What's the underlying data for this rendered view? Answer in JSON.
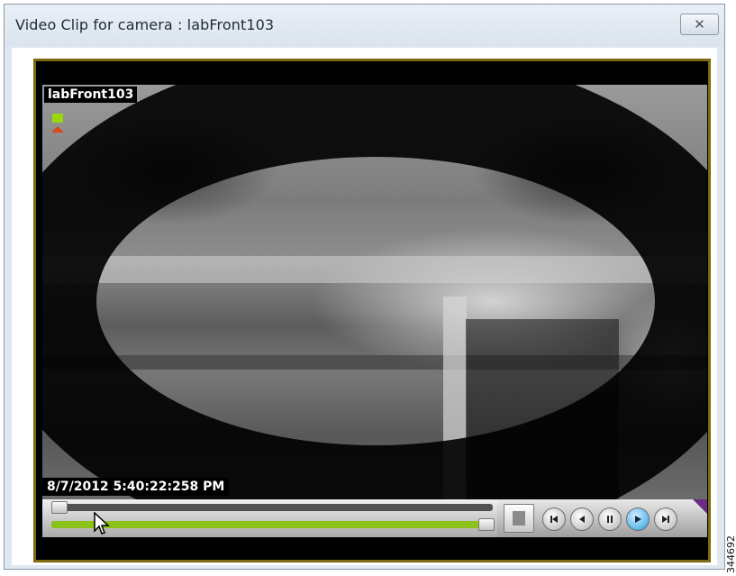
{
  "window": {
    "title": "Video Clip for camera : labFront103",
    "close_glyph": "✕"
  },
  "player": {
    "camera_label": "labFront103",
    "timestamp": "8/7/2012 5:40:22:258 PM",
    "status_icon": "camera-status-icon",
    "playback_progress": 0.98
  },
  "controls": {
    "stop_icon": "stop-icon",
    "buttons": [
      "skip-back-icon",
      "step-back-icon",
      "pause-icon",
      "play-icon",
      "skip-forward-icon"
    ]
  },
  "figure_id": "344692",
  "colors": {
    "frame_border": "#7d6a12",
    "progress": "#8bc31a",
    "active_button": "#59b7ea",
    "corner_mark": "#6b2a86"
  }
}
